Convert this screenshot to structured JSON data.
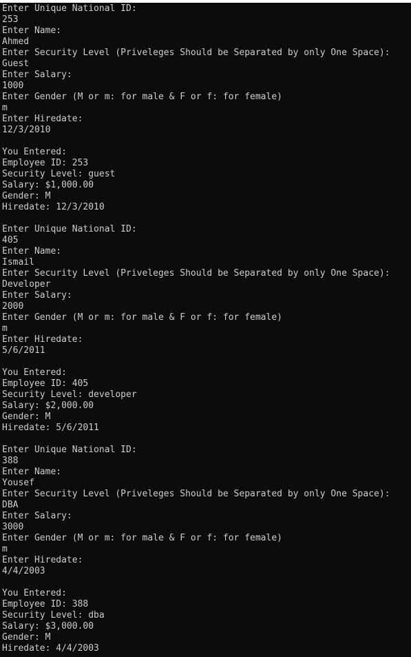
{
  "console": {
    "lines": [
      "Enter Unique National ID:",
      "253",
      "Enter Name:",
      "Ahmed",
      "Enter Security Level (Priveleges Should be Separated by only One Space):",
      "Guest",
      "Enter Salary:",
      "1000",
      "Enter Gender (M or m: for male & F or f: for female)",
      "m",
      "Enter Hiredate:",
      "12/3/2010",
      "",
      "You Entered:",
      "Employee ID: 253",
      "Security Level: guest",
      "Salary: $1,000.00",
      "Gender: M",
      "Hiredate: 12/3/2010",
      "",
      "Enter Unique National ID:",
      "405",
      "Enter Name:",
      "Ismail",
      "Enter Security Level (Priveleges Should be Separated by only One Space):",
      "Developer",
      "Enter Salary:",
      "2000",
      "Enter Gender (M or m: for male & F or f: for female)",
      "m",
      "Enter Hiredate:",
      "5/6/2011",
      "",
      "You Entered:",
      "Employee ID: 405",
      "Security Level: developer",
      "Salary: $2,000.00",
      "Gender: M",
      "Hiredate: 5/6/2011",
      "",
      "Enter Unique National ID:",
      "388",
      "Enter Name:",
      "Yousef",
      "Enter Security Level (Priveleges Should be Separated by only One Space):",
      "DBA",
      "Enter Salary:",
      "3000",
      "Enter Gender (M or m: for male & F or f: for female)",
      "m",
      "Enter Hiredate:",
      "4/4/2003",
      "",
      "You Entered:",
      "Employee ID: 388",
      "Security Level: dba",
      "Salary: $3,000.00",
      "Gender: M",
      "Hiredate: 4/4/2003"
    ]
  },
  "colors": {
    "background": "#0c0c0c",
    "text": "#cccccc"
  }
}
